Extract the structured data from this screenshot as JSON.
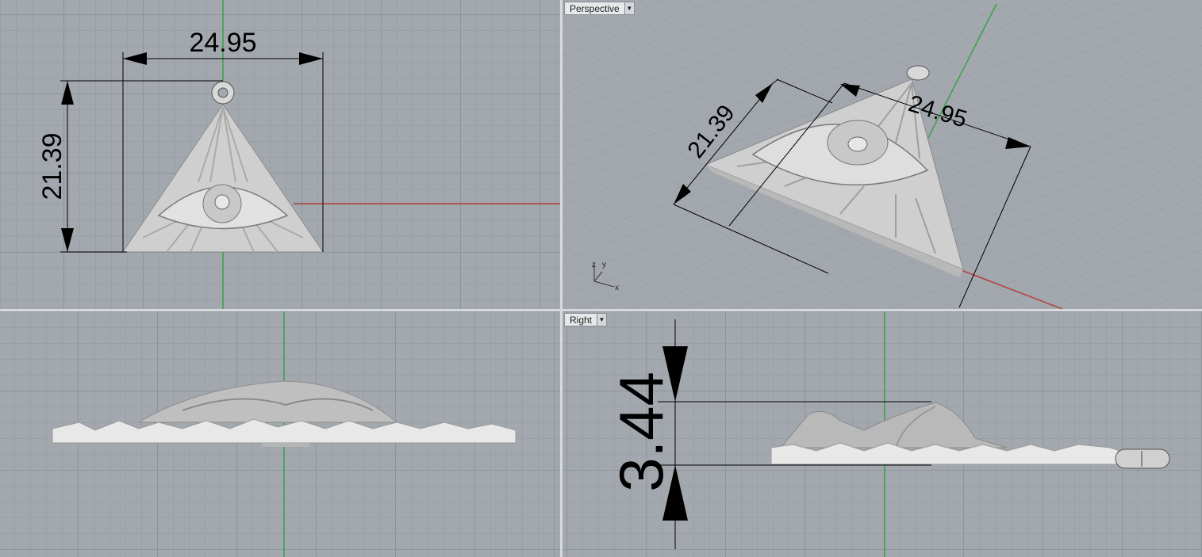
{
  "viewports": {
    "top": {
      "dimension_width": "24.95",
      "dimension_height": "21.39"
    },
    "perspective": {
      "label": "Perspective",
      "dimension_width": "24.95",
      "dimension_height": "21.39",
      "axis_z": "z",
      "axis_y": "y",
      "axis_x": "x"
    },
    "front": {},
    "right": {
      "label": "Right",
      "dimension_thickness": "3.44"
    }
  },
  "icons": {
    "dropdown": "chevron-down-icon"
  },
  "colors": {
    "x_axis": "#b0403c",
    "y_axis": "#3aa14a",
    "grid_bg": "#a3a8ae",
    "model": "#d3d3d3"
  }
}
